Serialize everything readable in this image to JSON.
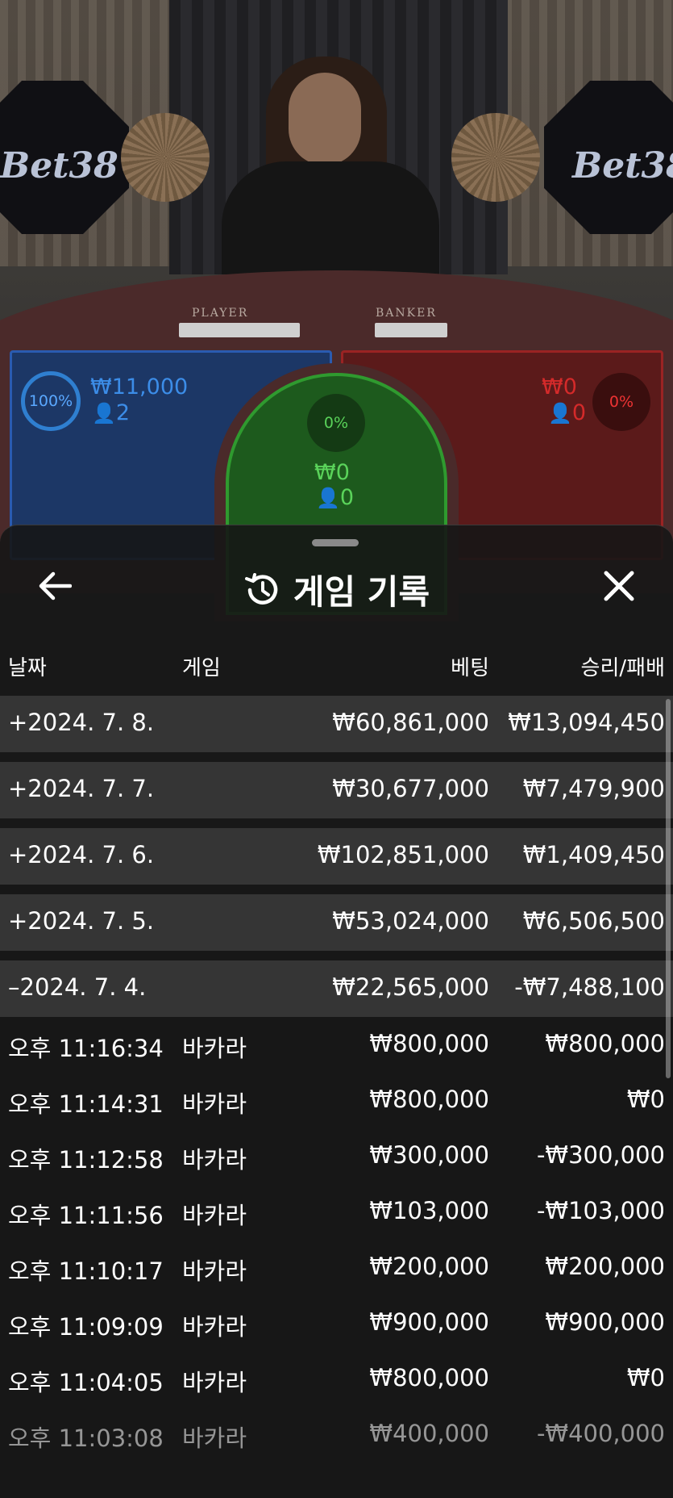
{
  "scene": {
    "logo_text": "Bet38",
    "table_labels": {
      "player": "PLAYER",
      "banker": "BANKER"
    },
    "player_bet": {
      "percent": "100%",
      "amount": "₩11,000",
      "count": "2",
      "color": "#2f7fd0"
    },
    "banker_bet": {
      "percent": "0%",
      "amount": "₩0",
      "count": "0",
      "color": "#e33333"
    },
    "tie_bet": {
      "percent": "0%",
      "amount": "₩0",
      "count": "0",
      "color": "#5ad35a"
    }
  },
  "history": {
    "title": "게임 기록",
    "back_icon": "arrow-left-icon",
    "history_icon": "history-clock-icon",
    "close_icon": "close-icon",
    "columns": {
      "date": "날짜",
      "game": "게임",
      "bet": "베팅",
      "winloss": "승리/패배"
    },
    "days": [
      {
        "date": "+2024. 7. 8.",
        "bet": "₩60,861,000",
        "winloss": "₩13,094,450"
      },
      {
        "date": "+2024. 7. 7.",
        "bet": "₩30,677,000",
        "winloss": "₩7,479,900"
      },
      {
        "date": "+2024. 7. 6.",
        "bet": "₩102,851,000",
        "winloss": "₩1,409,450"
      },
      {
        "date": "+2024. 7. 5.",
        "bet": "₩53,024,000",
        "winloss": "₩6,506,500"
      },
      {
        "date": "–2024. 7. 4.",
        "bet": "₩22,565,000",
        "winloss": "-₩7,488,100"
      }
    ],
    "games": [
      {
        "time": "오후 11:16:34",
        "game": "바카라",
        "bet": "₩800,000",
        "winloss": "₩800,000"
      },
      {
        "time": "오후 11:14:31",
        "game": "바카라",
        "bet": "₩800,000",
        "winloss": "₩0"
      },
      {
        "time": "오후 11:12:58",
        "game": "바카라",
        "bet": "₩300,000",
        "winloss": "-₩300,000"
      },
      {
        "time": "오후 11:11:56",
        "game": "바카라",
        "bet": "₩103,000",
        "winloss": "-₩103,000"
      },
      {
        "time": "오후 11:10:17",
        "game": "바카라",
        "bet": "₩200,000",
        "winloss": "₩200,000"
      },
      {
        "time": "오후 11:09:09",
        "game": "바카라",
        "bet": "₩900,000",
        "winloss": "₩900,000"
      },
      {
        "time": "오후 11:04:05",
        "game": "바카라",
        "bet": "₩800,000",
        "winloss": "₩0"
      },
      {
        "time": "오후 11:03:08",
        "game": "바카라",
        "bet": "₩400,000",
        "winloss": "-₩400,000"
      }
    ]
  }
}
